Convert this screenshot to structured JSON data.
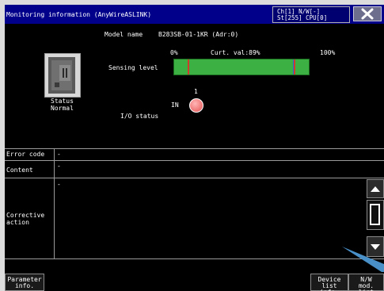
{
  "window": {
    "title": "Monitoring information (AnyWireASLINK)",
    "channel_line1": "Ch[1]   N/W[-]",
    "channel_line2": "St[255] CPU[0]"
  },
  "device": {
    "model_label": "Model name",
    "model_value": "B283SB-01-1KR (Adr:0)",
    "status_label": "Status",
    "status_value": "Normal"
  },
  "sensing": {
    "label": "Sensing level",
    "scale_min": "0%",
    "current_text": "Curt. val:89%",
    "scale_max": "100%",
    "current_value_percent": 89
  },
  "io": {
    "label": "I/O status",
    "signal": "IN",
    "bit_number": "1",
    "state_on": true
  },
  "info_table": {
    "error_code_label": "Error code",
    "error_code_value": "-",
    "content_label": "Content",
    "content_value": "-",
    "corrective_label_line1": "Corrective",
    "corrective_label_line2": "action",
    "corrective_value": "-"
  },
  "buttons": {
    "parameter_line1": "Parameter",
    "parameter_line2": "info.",
    "device_list_line1": "Device",
    "device_list_line2": "list info.",
    "nw_mod_line1": "N/W",
    "nw_mod_line2": "mod. list"
  },
  "colors": {
    "titlebar": "#00008b",
    "bar_fill": "#3cb043",
    "threshold_marker": "#d03c2c",
    "current_marker": "#1e6fd9",
    "led_on": "#f07a7a"
  }
}
